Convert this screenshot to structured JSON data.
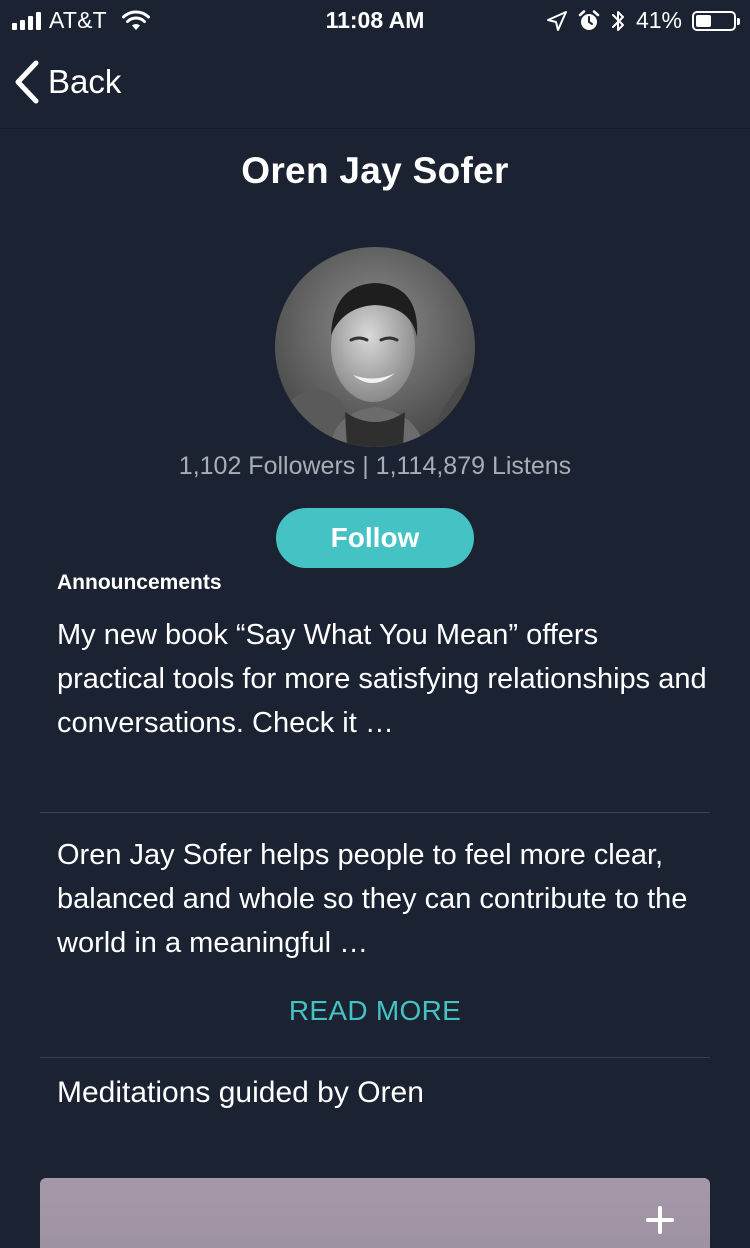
{
  "status_bar": {
    "carrier": "AT&T",
    "time": "11:08 AM",
    "battery_percent": "41%",
    "battery_level": 0.41,
    "icons": [
      "signal-icon",
      "wifi-icon",
      "location-icon",
      "alarm-icon",
      "bluetooth-icon",
      "battery-icon"
    ]
  },
  "nav": {
    "back_label": "Back",
    "back_icon": "chevron-left-icon"
  },
  "profile": {
    "name": "Oren Jay Sofer",
    "stats": "1,102 Followers | 1,114,879 Listens",
    "follow_label": "Follow"
  },
  "announcements": {
    "heading": "Announcements",
    "text": "My new book “Say What You Mean” offers practical tools for more satisfying relationships and conversations. Check it …"
  },
  "bio": {
    "text": "Oren Jay Sofer helps people to feel more clear, balanced and whole so they can contribute to the world in a meaningful …",
    "read_more_label": "READ MORE"
  },
  "meditations": {
    "heading": "Meditations guided by Oren",
    "card_icon": "plus-icon"
  },
  "colors": {
    "background": "#1b2231",
    "accent": "#45c2c4",
    "muted_text": "#a9adb4",
    "divider": "#3a4252",
    "card": "#a598a9"
  }
}
